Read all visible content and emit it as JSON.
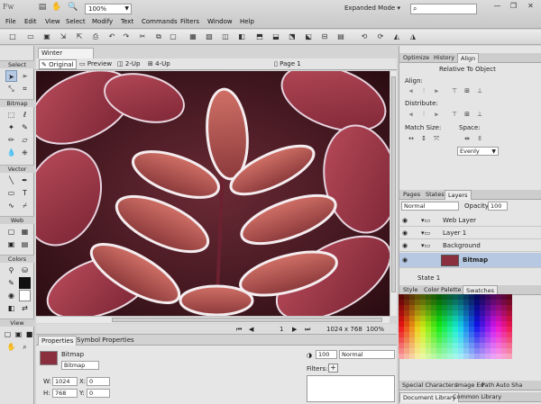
{
  "app": {
    "logo": "Fw",
    "zoom": "100%",
    "workspace": "Expanded Mode",
    "window_controls": [
      "minimize-icon",
      "restore-icon",
      "close-icon"
    ]
  },
  "menu": [
    "File",
    "Edit",
    "View",
    "Select",
    "Modify",
    "Text",
    "Commands",
    "Filters",
    "Window",
    "Help"
  ],
  "tools": {
    "sections": [
      "Select",
      "Bitmap",
      "Vector",
      "Web",
      "Colors",
      "View"
    ]
  },
  "document": {
    "tab": "Winter Leaves.jpg",
    "views": [
      "Original",
      "Preview",
      "2-Up",
      "4-Up"
    ],
    "page": "Page 1",
    "status_page": "1",
    "size": "1024 x 768",
    "zoom": "100%"
  },
  "properties": {
    "tabs": [
      "Properties",
      "Symbol Properties"
    ],
    "object_type": "Bitmap",
    "name": "Bitmap",
    "w_label": "W:",
    "w": "1024",
    "h_label": "H:",
    "h": "768",
    "x_label": "X:",
    "x": "0",
    "y_label": "Y:",
    "y": "0",
    "opacity": "100",
    "blend": "Normal",
    "filters_label": "Filters:"
  },
  "align_panel": {
    "tabs": [
      "Optimize",
      "History",
      "Align"
    ],
    "relative_to": "Relative To Object",
    "align_label": "Align:",
    "distribute_label": "Distribute:",
    "match_size_label": "Match Size:",
    "space_label": "Space:",
    "space_value": "Evenly"
  },
  "layers_panel": {
    "tabs": [
      "Pages",
      "States",
      "Layers"
    ],
    "blend": "Normal",
    "opacity_label": "Opacity",
    "opacity": "100",
    "rows": [
      "Web Layer",
      "Layer 1",
      "Background",
      "Bitmap"
    ],
    "state": "State 1"
  },
  "swatches_panel": {
    "tabs": [
      "Style",
      "Color Palette",
      "Swatches"
    ]
  },
  "bottom_tabs": {
    "row1": [
      "Special Characters",
      "Image Ed",
      "Path",
      "Auto Sha"
    ],
    "row2": [
      "Document Library",
      "Common Library"
    ]
  },
  "colors": {
    "selection": "#b7c9e2",
    "panel": "#e5e5e5"
  }
}
